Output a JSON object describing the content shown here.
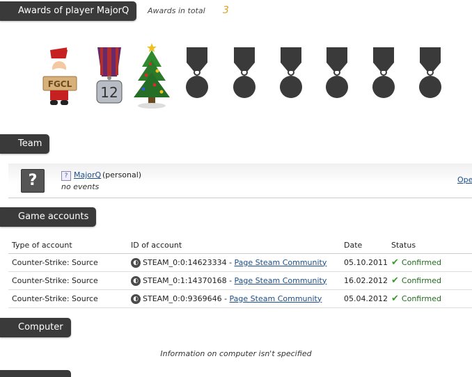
{
  "awards": {
    "title": "Awards of player MajorQ",
    "total_label": "Awards in total",
    "total_count": "3",
    "items": [
      {
        "name": "santa-award-icon",
        "label": "FGCL"
      },
      {
        "name": "medal-12-award-icon",
        "label": "12"
      },
      {
        "name": "christmas-tree-award-icon",
        "label": ""
      },
      {
        "name": "empty-medal-icon",
        "label": ""
      },
      {
        "name": "empty-medal-icon",
        "label": ""
      },
      {
        "name": "empty-medal-icon",
        "label": ""
      },
      {
        "name": "empty-medal-icon",
        "label": ""
      },
      {
        "name": "empty-medal-icon",
        "label": ""
      },
      {
        "name": "empty-medal-icon",
        "label": ""
      }
    ]
  },
  "team": {
    "title": "Team",
    "avatar_glyph": "?",
    "question_badge": "?",
    "player_name": "MajorQ",
    "personal": "(personal)",
    "events": "no events",
    "open_link": "Ope"
  },
  "game_accounts": {
    "title": "Game accounts",
    "columns": [
      "Type of account",
      "ID of account",
      "Date",
      "Status"
    ],
    "rows": [
      {
        "type": "Counter-Strike: Source",
        "id": "STEAM_0:0:14623334",
        "sep": " - ",
        "link": "Page Steam Community",
        "date": "05.10.2011",
        "status": "Confirmed"
      },
      {
        "type": "Counter-Strike: Source",
        "id": "STEAM_0:1:14370168",
        "sep": " - ",
        "link": "Page Steam Community",
        "date": "16.02.2012",
        "status": "Confirmed"
      },
      {
        "type": "Counter-Strike: Source",
        "id": "STEAM_0:0:9369646",
        "sep": " - ",
        "link": "Page Steam Community",
        "date": "05.04.2012",
        "status": "Confirmed"
      }
    ]
  },
  "computer": {
    "title": "Computer",
    "info": "Information on computer isn't specified"
  },
  "colors": {
    "tab_bg": "#3a3a3a",
    "count_accent": "#e0a020",
    "link": "#1a4d8c",
    "confirmed": "#1e6b1a"
  }
}
